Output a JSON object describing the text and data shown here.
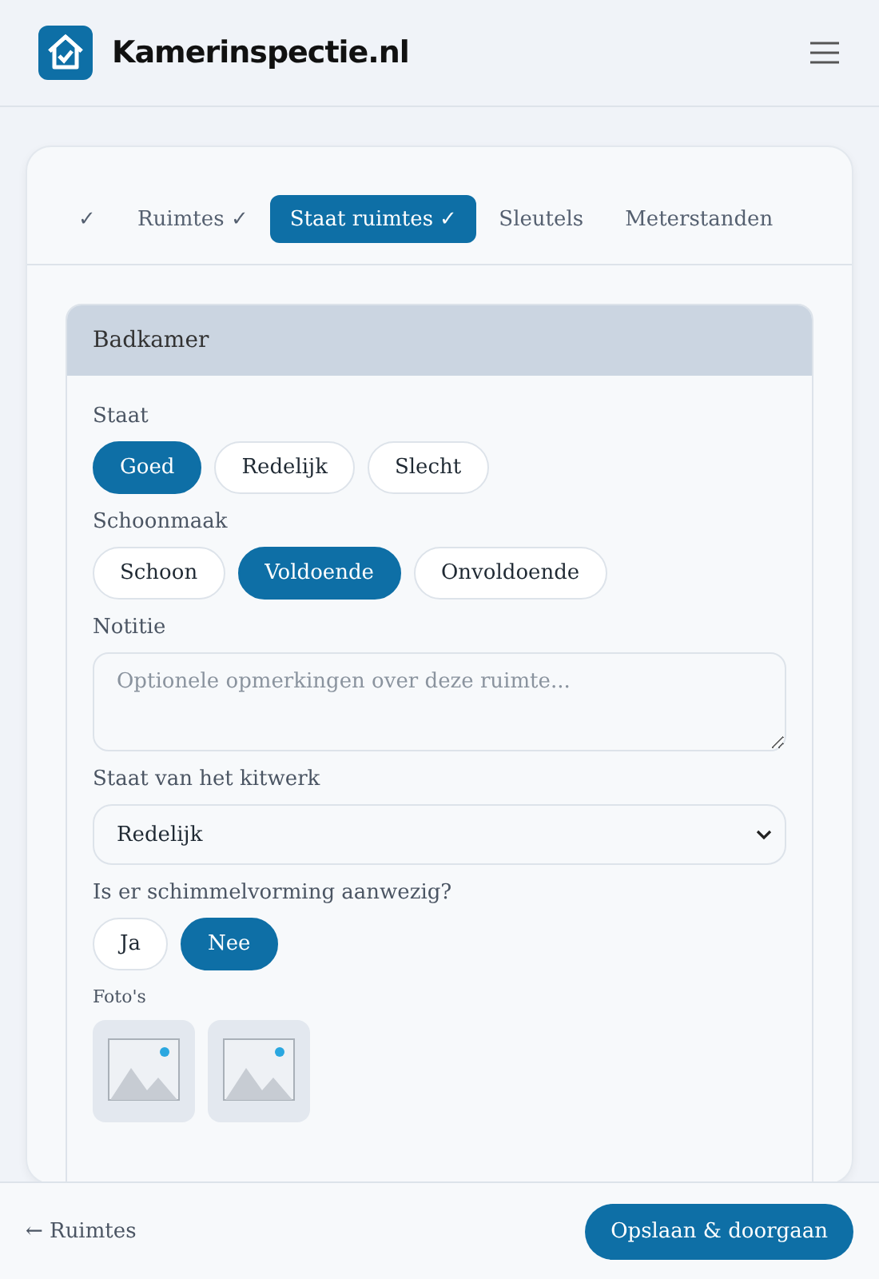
{
  "header": {
    "brand": "Kamerinspectie.nl"
  },
  "steps": [
    {
      "check": "✓",
      "selected": false
    },
    {
      "label": "Ruimtes",
      "check": "✓",
      "selected": false
    },
    {
      "label": "Staat ruimtes",
      "check": "✓",
      "selected": true
    },
    {
      "label": "Sleutels",
      "selected": false
    },
    {
      "label": "Meterstanden",
      "selected": false
    }
  ],
  "room": {
    "title": "Badkamer",
    "groups": [
      {
        "label": "Staat",
        "options": [
          {
            "label": "Goed",
            "selected": true
          },
          {
            "label": "Redelijk",
            "selected": false
          },
          {
            "label": "Slecht",
            "selected": false
          }
        ]
      },
      {
        "label": "Schoonmaak",
        "options": [
          {
            "label": "Schoon",
            "selected": false
          },
          {
            "label": "Voldoende",
            "selected": true
          },
          {
            "label": "Onvoldoende",
            "selected": false
          }
        ]
      }
    ],
    "note": {
      "label": "Notitie",
      "placeholder": "Optionele opmerkingen over deze ruimte..."
    },
    "sealant": {
      "label": "Staat van het kitwerk",
      "value": "Redelijk"
    },
    "mold": {
      "label": "Is er schimmelvorming aanwezig?",
      "options": [
        {
          "label": "Ja",
          "selected": false
        },
        {
          "label": "Nee",
          "selected": true
        }
      ]
    },
    "photos": {
      "label": "Foto's"
    }
  },
  "footer": {
    "back": "← Ruimtes",
    "next": "Opslaan & doorgaan"
  }
}
